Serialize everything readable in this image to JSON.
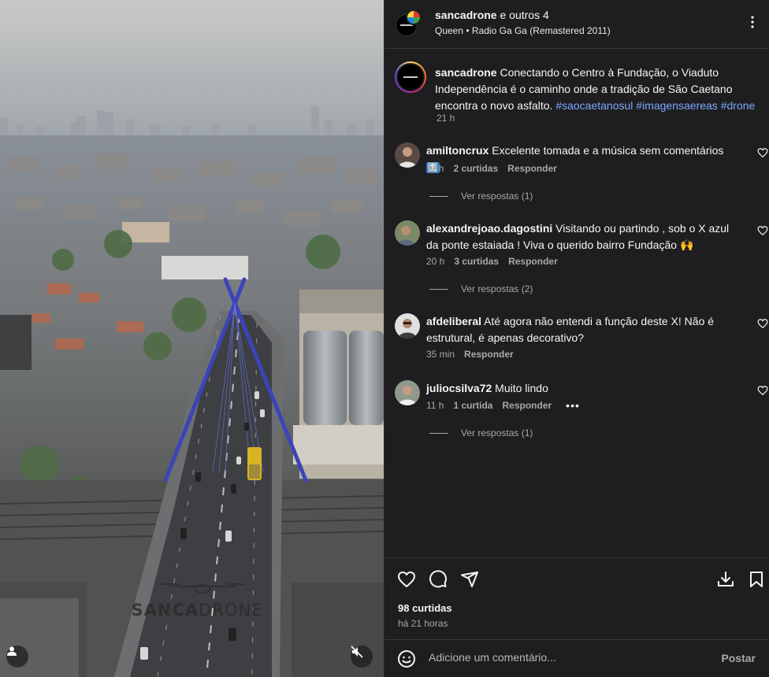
{
  "media": {
    "watermark_line1": "SANCA",
    "watermark_line2": "DRONE"
  },
  "header": {
    "username": "sancadrone",
    "others": " e outros 4",
    "artist": "Queen",
    "separator": "•",
    "song": "Radio Ga Ga (Remastered 2011)"
  },
  "caption": {
    "username": "sancadrone",
    "text": " Conectando o Centro à Fundação, o Viaduto Independência é o caminho onde a tradição de São Caetano encontra o novo asfalto. ",
    "hashtags": [
      "#saocaetanosul",
      "#imagensaereas",
      "#drone"
    ],
    "time": "21 h"
  },
  "comments": [
    {
      "username": "amiltoncrux",
      "text": " Excelente tomada e a música sem comentários",
      "emoji": "🔝",
      "time": "11 h",
      "likes": "2 curtidas",
      "reply_label": "Responder",
      "view_replies": "Ver respostas (1)"
    },
    {
      "username": "alexandrejoao.dagostini",
      "text": " Visitando ou partindo , sob o X azul da ponte estaiada ! Viva o querido bairro Fundação",
      "emoji": "🙌",
      "time": "20 h",
      "likes": "3 curtidas",
      "reply_label": "Responder",
      "view_replies": "Ver respostas (2)"
    },
    {
      "username": "afdeliberal",
      "text": " Até agora não entendi a função deste X! Não é estrutural, é apenas decorativo?",
      "time": "35 min",
      "reply_label": "Responder"
    },
    {
      "username": "juliocsilva72",
      "text": " Muito lindo",
      "time": "11 h",
      "likes": "1 curtida",
      "reply_label": "Responder",
      "more": "•••",
      "view_replies": "Ver respostas (1)"
    }
  ],
  "footer": {
    "likes": "98 curtidas",
    "time_ago": "há 21 horas",
    "comment_placeholder": "Adicione um comentário...",
    "post_label": "Postar"
  },
  "icons": [
    "heart-icon",
    "comment-icon",
    "share-icon",
    "save-icon",
    "download-icon",
    "emoji-icon",
    "more-icon",
    "mute-icon",
    "user-tag-icon"
  ],
  "colors": {
    "panel_bg": "#1e1e20",
    "hashtag": "#7ea6ff",
    "muted_text": "#a8a8a8",
    "bridge_blue": "#3b44b8"
  }
}
